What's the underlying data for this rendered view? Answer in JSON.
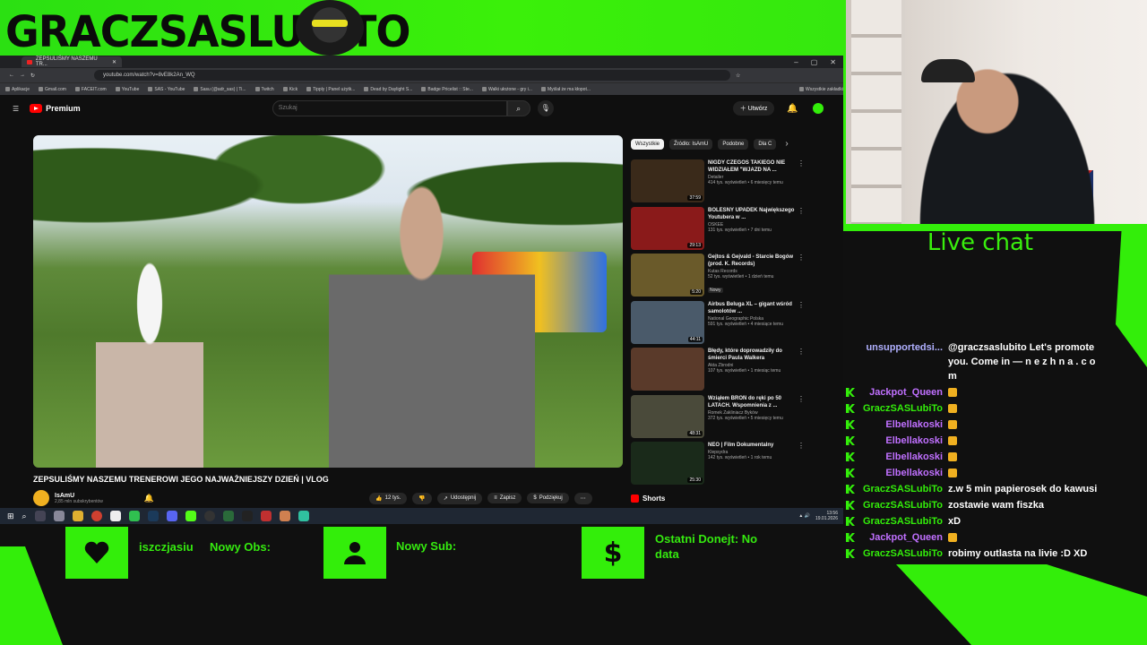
{
  "overlay": {
    "logo_text": "GRACZSASLUBITO",
    "accent": "#33ee0a",
    "chat_title": "Live chat"
  },
  "browser": {
    "tab_title": "ZEPSULIŚMY NASZEMU TR...",
    "url": "youtube.com/watch?v=8vE8k2An_WQ",
    "bookmarks": [
      "Aplikacje",
      "Gmail.com",
      "FACEIT.com",
      "YouTube",
      "SAS - YouTube",
      "Sasu (@adr_sas) | Ti...",
      "Twitch",
      "Kick",
      "Tipply | Panel użytk...",
      "Dead by Daylight S...",
      "Badge Pricelist :: Ste...",
      "Walki ułożone - gry i...",
      "Myślał że ma kłopot...",
      "Wszystkie zakładki"
    ]
  },
  "youtube": {
    "logo": "Premium",
    "search_placeholder": "Szukaj",
    "create_label": "Utwórz",
    "video_title": "ZEPSULIŚMY NASZEMU TRENEROWI JEGO NAJWAŻNIEJSZY DZIEŃ | VLOG",
    "channel_name": "IsAmU",
    "channel_subs": "2,85 mln subskrybentów",
    "likes": "12 tys.",
    "share_label": "Udostępnij",
    "save_label": "Zapisz",
    "thanks_label": "Podziękuj",
    "chips": [
      "Wszystkie",
      "Źródło: IsAmU",
      "Podobne",
      "Dla C"
    ],
    "recommended": [
      {
        "title": "NIGDY CZEGOŚ TAKIEGO NIE WIDZIAŁEM \"WJAZD NA ...",
        "channel": "Detailer",
        "stats": "414 tys. wyświetleń • 6 miesięcy temu",
        "duration": "37:59",
        "thumb": "#3a2a1a"
      },
      {
        "title": "BOLESNY UPADEK Największego Youtubera w ...",
        "channel": "OSKEE",
        "stats": "131 tys. wyświetleń • 7 dni temu",
        "duration": "29:13",
        "thumb": "#8a1a1a"
      },
      {
        "title": "Gejtos & Gejvald - Starcie Bogów (prod. K. Records)",
        "channel": "Kutas Records",
        "stats": "52 tys. wyświetleń • 1 dzień temu",
        "duration": "5:20",
        "thumb": "#6a5a2a",
        "badge": "Nowy"
      },
      {
        "title": "Airbus Beluga XL – gigant wśród samolotów ...",
        "channel": "National Geographic Polska",
        "stats": "591 tys. wyświetleń • 4 miesiące temu",
        "duration": "44:11",
        "thumb": "#4a5a6a"
      },
      {
        "title": "Błędy, które doprowadziły do śmierci Paula Walkera",
        "channel": "Akta Zbrodni",
        "stats": "107 tys. wyświetleń • 1 miesiąc temu",
        "duration": "",
        "thumb": "#5a3a2a"
      },
      {
        "title": "Wziąłem BROŃ do ręki po 50 LATACH. Wspomnienia z ...",
        "channel": "Romek Zakliniacz Byków",
        "stats": "372 tys. wyświetleń • 5 miesięcy temu",
        "duration": "48:31",
        "thumb": "#4a4a3a"
      },
      {
        "title": "NEO | Film Dokumentalny",
        "channel": "Klepsydra",
        "stats": "142 tys. wyświetleń • 1 rok temu",
        "duration": "25:30",
        "thumb": "#1a2a1a"
      }
    ],
    "shorts_label": "Shorts"
  },
  "taskbar": {
    "time": "13:56",
    "date": "19.01.2026"
  },
  "chat": [
    {
      "user": "unsupportedsi...",
      "color": "#b0b0ff",
      "text": "@graczsaslubito Let's promote you. Come in — n e z h n a . c o m",
      "badge": false
    },
    {
      "user": "Jackpot_Queen",
      "color": "#c070ff",
      "text": "",
      "badge": true
    },
    {
      "user": "GraczSASLubiTo",
      "color": "#33ee0a",
      "text": "",
      "badge": true
    },
    {
      "user": "Elbellakoski",
      "color": "#c070ff",
      "text": "",
      "badge": true
    },
    {
      "user": "Elbellakoski",
      "color": "#c070ff",
      "text": "",
      "badge": true
    },
    {
      "user": "Elbellakoski",
      "color": "#c070ff",
      "text": "",
      "badge": true
    },
    {
      "user": "Elbellakoski",
      "color": "#c070ff",
      "text": "",
      "badge": true
    },
    {
      "user": "GraczSASLubiTo",
      "color": "#33ee0a",
      "text": "z.w 5 min papierosek do kawusi",
      "badge": true
    },
    {
      "user": "GraczSASLubiTo",
      "color": "#33ee0a",
      "text": "zostawie wam fiszka",
      "badge": true
    },
    {
      "user": "GraczSASLubiTo",
      "color": "#33ee0a",
      "text": "xD",
      "badge": true
    },
    {
      "user": "Jackpot_Queen",
      "color": "#c070ff",
      "text": "",
      "badge": true
    },
    {
      "user": "GraczSASLubiTo",
      "color": "#33ee0a",
      "text": "robimy outlasta na livie :D XD",
      "badge": true
    }
  ],
  "alerts": {
    "follow_label": "iszczjasiu",
    "new_follower": "Nowy Obs:",
    "new_sub": "Nowy Sub:",
    "last_donation": "Ostatni Donejt: No data"
  }
}
